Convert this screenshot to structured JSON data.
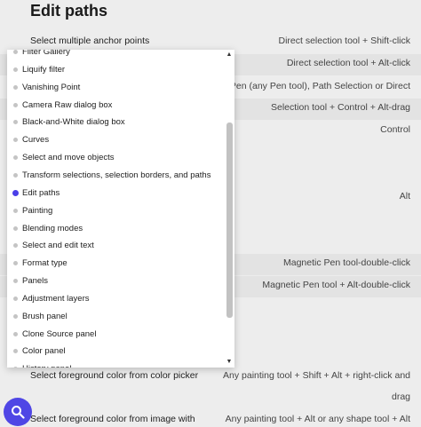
{
  "page": {
    "title": "Edit paths"
  },
  "background_rows": [
    {
      "left": "Select multiple anchor points",
      "right": "Direct selection tool + Shift-click"
    },
    {
      "left": "",
      "right": "Direct selection tool + Alt-click"
    },
    {
      "left": "",
      "right": "Pen (any Pen tool), Path Selection or Direct"
    },
    {
      "left": "",
      "right": "Selection tool + Control + Alt-drag"
    },
    {
      "left": "",
      "right": "Control"
    },
    {
      "left": "",
      "right": "Alt"
    },
    {
      "left": "",
      "right": "Magnetic Pen tool-double-click"
    },
    {
      "left": "",
      "right": "Magnetic Pen tool + Alt-double-click"
    },
    {
      "left": "Select foreground color from color picker",
      "right": "Any painting tool + Shift + Alt + right-click and"
    },
    {
      "left": "",
      "right": "drag"
    },
    {
      "left": "Select foreground color from image with",
      "right": "Any painting tool + Alt or any shape tool + Alt"
    }
  ],
  "dropdown": {
    "items": [
      {
        "label": "Filter Gallery",
        "active": false
      },
      {
        "label": "Liquify filter",
        "active": false
      },
      {
        "label": "Vanishing Point",
        "active": false
      },
      {
        "label": "Camera Raw dialog box",
        "active": false
      },
      {
        "label": "Black-and-White dialog box",
        "active": false
      },
      {
        "label": "Curves",
        "active": false
      },
      {
        "label": "Select and move objects",
        "active": false
      },
      {
        "label": "Transform selections, selection borders, and paths",
        "active": false
      },
      {
        "label": "Edit paths",
        "active": true
      },
      {
        "label": "Painting",
        "active": false
      },
      {
        "label": "Blending modes",
        "active": false
      },
      {
        "label": "Select and edit text",
        "active": false
      },
      {
        "label": "Format type",
        "active": false
      },
      {
        "label": "Panels",
        "active": false
      },
      {
        "label": "Adjustment layers",
        "active": false
      },
      {
        "label": "Brush panel",
        "active": false
      },
      {
        "label": "Clone Source panel",
        "active": false
      },
      {
        "label": "Color panel",
        "active": false
      },
      {
        "label": "History panel",
        "active": false
      }
    ],
    "scroll_up_glyph": "▲",
    "scroll_down_glyph": "▼"
  },
  "search_button": {
    "icon": "search-icon"
  },
  "colors": {
    "accent": "#4f46e5",
    "active_dot": "#4a3fe8",
    "background": "#ededed"
  }
}
